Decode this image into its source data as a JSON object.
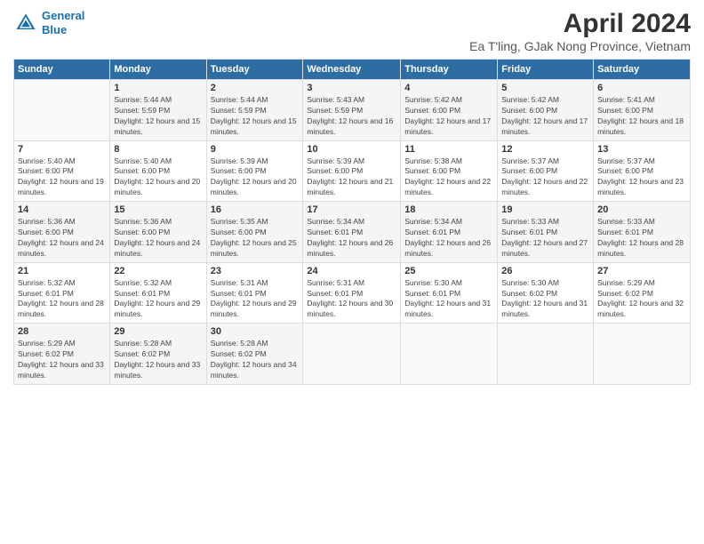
{
  "logo": {
    "line1": "General",
    "line2": "Blue"
  },
  "title": "April 2024",
  "subtitle": "Ea T'ling, GJak Nong Province, Vietnam",
  "days_of_week": [
    "Sunday",
    "Monday",
    "Tuesday",
    "Wednesday",
    "Thursday",
    "Friday",
    "Saturday"
  ],
  "weeks": [
    [
      {
        "day": "",
        "sunrise": "",
        "sunset": "",
        "daylight": ""
      },
      {
        "day": "1",
        "sunrise": "Sunrise: 5:44 AM",
        "sunset": "Sunset: 5:59 PM",
        "daylight": "Daylight: 12 hours and 15 minutes."
      },
      {
        "day": "2",
        "sunrise": "Sunrise: 5:44 AM",
        "sunset": "Sunset: 5:59 PM",
        "daylight": "Daylight: 12 hours and 15 minutes."
      },
      {
        "day": "3",
        "sunrise": "Sunrise: 5:43 AM",
        "sunset": "Sunset: 5:59 PM",
        "daylight": "Daylight: 12 hours and 16 minutes."
      },
      {
        "day": "4",
        "sunrise": "Sunrise: 5:42 AM",
        "sunset": "Sunset: 6:00 PM",
        "daylight": "Daylight: 12 hours and 17 minutes."
      },
      {
        "day": "5",
        "sunrise": "Sunrise: 5:42 AM",
        "sunset": "Sunset: 6:00 PM",
        "daylight": "Daylight: 12 hours and 17 minutes."
      },
      {
        "day": "6",
        "sunrise": "Sunrise: 5:41 AM",
        "sunset": "Sunset: 6:00 PM",
        "daylight": "Daylight: 12 hours and 18 minutes."
      }
    ],
    [
      {
        "day": "7",
        "sunrise": "Sunrise: 5:40 AM",
        "sunset": "Sunset: 6:00 PM",
        "daylight": "Daylight: 12 hours and 19 minutes."
      },
      {
        "day": "8",
        "sunrise": "Sunrise: 5:40 AM",
        "sunset": "Sunset: 6:00 PM",
        "daylight": "Daylight: 12 hours and 20 minutes."
      },
      {
        "day": "9",
        "sunrise": "Sunrise: 5:39 AM",
        "sunset": "Sunset: 6:00 PM",
        "daylight": "Daylight: 12 hours and 20 minutes."
      },
      {
        "day": "10",
        "sunrise": "Sunrise: 5:39 AM",
        "sunset": "Sunset: 6:00 PM",
        "daylight": "Daylight: 12 hours and 21 minutes."
      },
      {
        "day": "11",
        "sunrise": "Sunrise: 5:38 AM",
        "sunset": "Sunset: 6:00 PM",
        "daylight": "Daylight: 12 hours and 22 minutes."
      },
      {
        "day": "12",
        "sunrise": "Sunrise: 5:37 AM",
        "sunset": "Sunset: 6:00 PM",
        "daylight": "Daylight: 12 hours and 22 minutes."
      },
      {
        "day": "13",
        "sunrise": "Sunrise: 5:37 AM",
        "sunset": "Sunset: 6:00 PM",
        "daylight": "Daylight: 12 hours and 23 minutes."
      }
    ],
    [
      {
        "day": "14",
        "sunrise": "Sunrise: 5:36 AM",
        "sunset": "Sunset: 6:00 PM",
        "daylight": "Daylight: 12 hours and 24 minutes."
      },
      {
        "day": "15",
        "sunrise": "Sunrise: 5:36 AM",
        "sunset": "Sunset: 6:00 PM",
        "daylight": "Daylight: 12 hours and 24 minutes."
      },
      {
        "day": "16",
        "sunrise": "Sunrise: 5:35 AM",
        "sunset": "Sunset: 6:00 PM",
        "daylight": "Daylight: 12 hours and 25 minutes."
      },
      {
        "day": "17",
        "sunrise": "Sunrise: 5:34 AM",
        "sunset": "Sunset: 6:01 PM",
        "daylight": "Daylight: 12 hours and 26 minutes."
      },
      {
        "day": "18",
        "sunrise": "Sunrise: 5:34 AM",
        "sunset": "Sunset: 6:01 PM",
        "daylight": "Daylight: 12 hours and 26 minutes."
      },
      {
        "day": "19",
        "sunrise": "Sunrise: 5:33 AM",
        "sunset": "Sunset: 6:01 PM",
        "daylight": "Daylight: 12 hours and 27 minutes."
      },
      {
        "day": "20",
        "sunrise": "Sunrise: 5:33 AM",
        "sunset": "Sunset: 6:01 PM",
        "daylight": "Daylight: 12 hours and 28 minutes."
      }
    ],
    [
      {
        "day": "21",
        "sunrise": "Sunrise: 5:32 AM",
        "sunset": "Sunset: 6:01 PM",
        "daylight": "Daylight: 12 hours and 28 minutes."
      },
      {
        "day": "22",
        "sunrise": "Sunrise: 5:32 AM",
        "sunset": "Sunset: 6:01 PM",
        "daylight": "Daylight: 12 hours and 29 minutes."
      },
      {
        "day": "23",
        "sunrise": "Sunrise: 5:31 AM",
        "sunset": "Sunset: 6:01 PM",
        "daylight": "Daylight: 12 hours and 29 minutes."
      },
      {
        "day": "24",
        "sunrise": "Sunrise: 5:31 AM",
        "sunset": "Sunset: 6:01 PM",
        "daylight": "Daylight: 12 hours and 30 minutes."
      },
      {
        "day": "25",
        "sunrise": "Sunrise: 5:30 AM",
        "sunset": "Sunset: 6:01 PM",
        "daylight": "Daylight: 12 hours and 31 minutes."
      },
      {
        "day": "26",
        "sunrise": "Sunrise: 5:30 AM",
        "sunset": "Sunset: 6:02 PM",
        "daylight": "Daylight: 12 hours and 31 minutes."
      },
      {
        "day": "27",
        "sunrise": "Sunrise: 5:29 AM",
        "sunset": "Sunset: 6:02 PM",
        "daylight": "Daylight: 12 hours and 32 minutes."
      }
    ],
    [
      {
        "day": "28",
        "sunrise": "Sunrise: 5:29 AM",
        "sunset": "Sunset: 6:02 PM",
        "daylight": "Daylight: 12 hours and 33 minutes."
      },
      {
        "day": "29",
        "sunrise": "Sunrise: 5:28 AM",
        "sunset": "Sunset: 6:02 PM",
        "daylight": "Daylight: 12 hours and 33 minutes."
      },
      {
        "day": "30",
        "sunrise": "Sunrise: 5:28 AM",
        "sunset": "Sunset: 6:02 PM",
        "daylight": "Daylight: 12 hours and 34 minutes."
      },
      {
        "day": "",
        "sunrise": "",
        "sunset": "",
        "daylight": ""
      },
      {
        "day": "",
        "sunrise": "",
        "sunset": "",
        "daylight": ""
      },
      {
        "day": "",
        "sunrise": "",
        "sunset": "",
        "daylight": ""
      },
      {
        "day": "",
        "sunrise": "",
        "sunset": "",
        "daylight": ""
      }
    ]
  ]
}
